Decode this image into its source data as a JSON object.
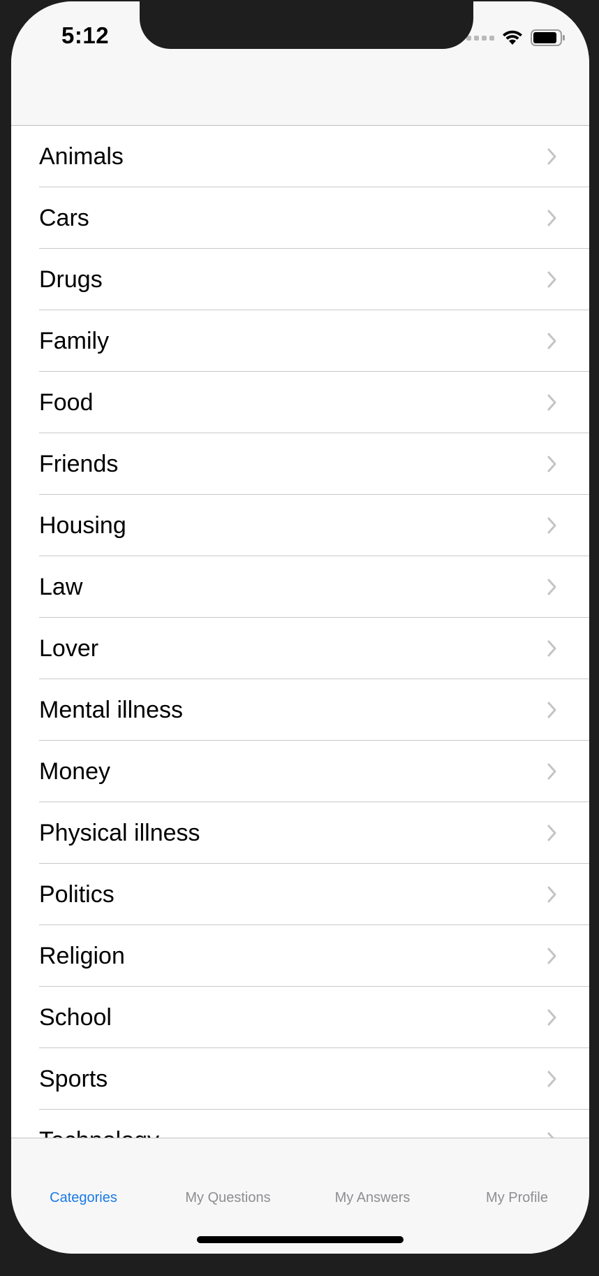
{
  "status_bar": {
    "time": "5:12"
  },
  "categories": [
    {
      "label": "Animals"
    },
    {
      "label": "Cars"
    },
    {
      "label": "Drugs"
    },
    {
      "label": "Family"
    },
    {
      "label": "Food"
    },
    {
      "label": "Friends"
    },
    {
      "label": "Housing"
    },
    {
      "label": "Law"
    },
    {
      "label": "Lover"
    },
    {
      "label": "Mental illness"
    },
    {
      "label": "Money"
    },
    {
      "label": "Physical illness"
    },
    {
      "label": "Politics"
    },
    {
      "label": "Religion"
    },
    {
      "label": "School"
    },
    {
      "label": "Sports"
    },
    {
      "label": "Technology"
    }
  ],
  "tab_bar": {
    "tabs": [
      {
        "label": "Categories",
        "active": true
      },
      {
        "label": "My Questions",
        "active": false
      },
      {
        "label": "My Answers",
        "active": false
      },
      {
        "label": "My Profile",
        "active": false
      }
    ]
  },
  "colors": {
    "accent": "#1a7ae6",
    "inactive_tab": "#8e8e93",
    "chevron": "#c4c4c7"
  }
}
